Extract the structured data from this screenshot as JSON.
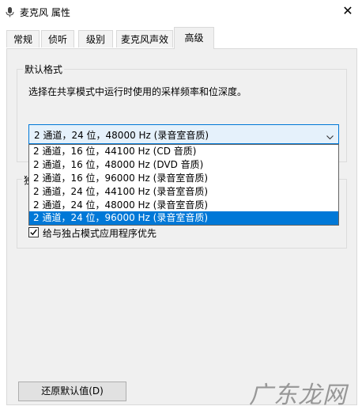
{
  "window": {
    "title": "麦克风 属性",
    "close_glyph": "✕"
  },
  "tabs": [
    {
      "label": "常规"
    },
    {
      "label": "侦听"
    },
    {
      "label": "级别"
    },
    {
      "label": "麦克风声效"
    },
    {
      "label": "高级",
      "active": true
    }
  ],
  "default_format": {
    "legend": "默认格式",
    "description": "选择在共享模式中运行时使用的采样频率和位深度。",
    "selected_value": "2 通道，24 位，48000 Hz (录音室音质)",
    "options": [
      "2 通道，16 位，44100 Hz (CD 音质)",
      "2 通道，16 位，48000 Hz (DVD 音质)",
      "2 通道，16 位，96000 Hz (录音室音质)",
      "2 通道，24 位，44100 Hz (录音室音质)",
      "2 通道，24 位，48000 Hz (录音室音质)",
      "2 通道，24 位，96000 Hz (录音室音质)"
    ],
    "highlighted_index": 5
  },
  "exclusive_mode": {
    "legend_partial": "独",
    "priority_checkbox_label": "给与独占模式应用程序优先",
    "priority_checked": true
  },
  "restore_button_label": "还原默认值(D)",
  "watermark_text": "广东龙网",
  "colors": {
    "accent": "#0078d7",
    "panel_bg": "#f0f0f0"
  }
}
